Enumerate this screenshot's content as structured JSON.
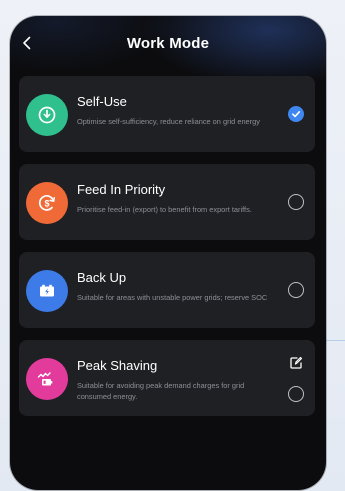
{
  "header": {
    "title": "Work Mode",
    "back_icon": "chevron-left-icon"
  },
  "colors": {
    "selected_radio": "#3f87f0",
    "card_background": "#1f2024",
    "self_use_icon": "#2fc08e",
    "feed_in_icon": "#f06a37",
    "back_up_icon": "#3d7be8",
    "peak_shaving_icon": "#e23b9c"
  },
  "modes": [
    {
      "name": "Self-Use",
      "description": "Optimise self-sufficiency, reduce reliance on grid energy",
      "icon": "leaf-power-icon",
      "selected": true
    },
    {
      "name": "Feed In Priority",
      "description": "Prioritise feed-in (export) to benefit from export tariffs.",
      "icon": "dollar-cycle-icon",
      "selected": false
    },
    {
      "name": "Back Up",
      "description": "Suitable for areas with unstable power grids; reserve SOC",
      "icon": "battery-backup-icon",
      "selected": false
    },
    {
      "name": "Peak Shaving",
      "description": "Suitable for avoiding peak demand charges for grid consumed energy.",
      "icon": "peak-shaving-icon",
      "selected": false,
      "edit_icon": "edit-icon"
    }
  ]
}
